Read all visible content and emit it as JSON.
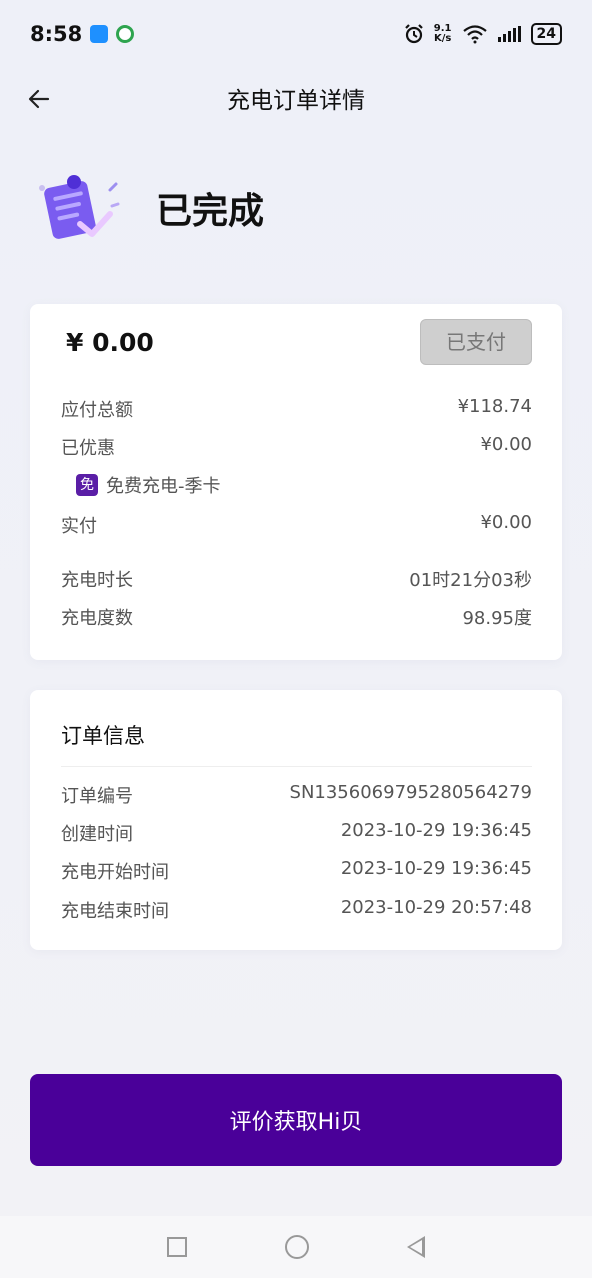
{
  "status_bar": {
    "time": "8:58",
    "net_speed_value": "9.1",
    "net_speed_unit": "K/s",
    "battery": "24"
  },
  "header": {
    "title": "充电订单详情"
  },
  "order": {
    "status": "已完成"
  },
  "payment": {
    "amount": "¥ 0.00",
    "paid_label": "已支付",
    "rows": [
      {
        "label": "应付总额",
        "value": "¥118.74"
      },
      {
        "label": "已优惠",
        "value": "¥0.00"
      },
      {
        "label": "实付",
        "value": "¥0.00"
      },
      {
        "label": "充电时长",
        "value": "01时21分03秒"
      },
      {
        "label": "充电度数",
        "value": "98.95度"
      }
    ],
    "coupon_badge": "免",
    "coupon_name": "免费充电-季卡"
  },
  "order_info": {
    "title": "订单信息",
    "rows": [
      {
        "label": "订单编号",
        "value": "SN1356069795280564279"
      },
      {
        "label": "创建时间",
        "value": "2023-10-29 19:36:45"
      },
      {
        "label": "充电开始时间",
        "value": "2023-10-29 19:36:45"
      },
      {
        "label": "充电结束时间",
        "value": "2023-10-29 20:57:48"
      }
    ]
  },
  "cta": {
    "label": "评价获取Hi贝"
  },
  "colors": {
    "accent": "#4a0099",
    "coupon_badge": "#5a1ea6",
    "paid_button_bg": "#cfcfcf"
  }
}
